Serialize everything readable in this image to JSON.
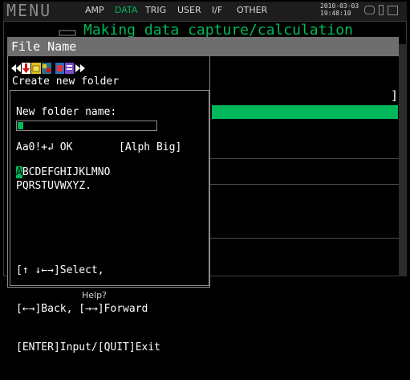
{
  "topbar": {
    "title": "MENU",
    "tabs": [
      {
        "label": "AMP",
        "active": false
      },
      {
        "label": "DATA",
        "active": true
      },
      {
        "label": "TRIG",
        "active": false
      },
      {
        "label": "USER",
        "active": false
      },
      {
        "label": "I/F",
        "active": false
      },
      {
        "label": "OTHER",
        "active": false
      }
    ],
    "date": "2010-03-03",
    "time": "19:48:10",
    "accent_color": "#00b85a"
  },
  "background_window": {
    "title": "Making data capture/calculation settings",
    "bracket": "]"
  },
  "dialog": {
    "title": "File Name",
    "toolbar_icons": [
      "rewind-icon",
      "red-arrow-icon",
      "folder-icon",
      "panel-icon",
      "red-square-icon",
      "purple-list-icon",
      "forward-icon"
    ],
    "create_label": "Create new folder",
    "folder_name_label": "New folder name:",
    "folder_name_value": "",
    "mode_left": "Aa0!+↲ OK",
    "mode_right": "[Alph Big]",
    "selected_char": "A",
    "chars_row1_rest": "BCDEFGHIJKLMNO",
    "chars_row2": "PQRSTUVWXYZ.",
    "help": {
      "line1": "[↑ ↓←→]Select,",
      "line2": "[←→]Back, [→→]Forward",
      "line3": "[ENTER]Input/[QUIT]Exit"
    }
  },
  "footer": {
    "help_label": "Help?"
  }
}
